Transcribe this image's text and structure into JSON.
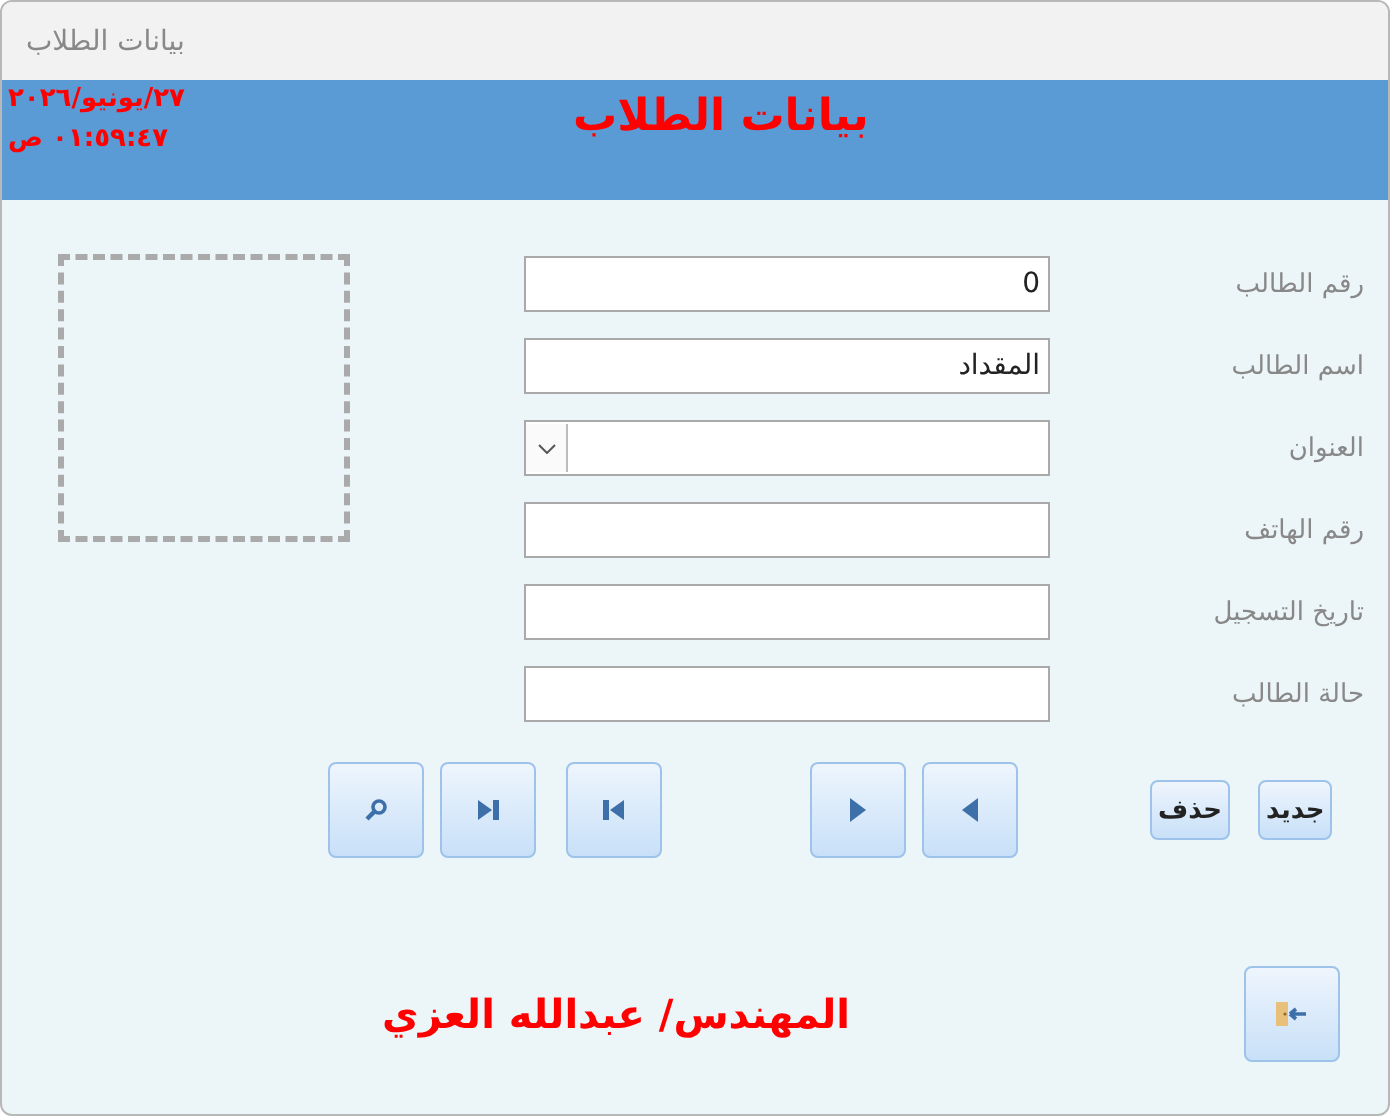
{
  "window": {
    "title": "بيانات الطلاب"
  },
  "header": {
    "title": "بيانات الطلاب",
    "date": "٢٧/يونيو/٢٠٢٦",
    "time": "٠١:٥٩:٤٧ ص"
  },
  "fields": [
    {
      "label": "رقم الطالب",
      "kind": "text",
      "value": "0"
    },
    {
      "label": "اسم الطالب",
      "kind": "text",
      "value": "المقداد"
    },
    {
      "label": "العنوان",
      "kind": "combo"
    },
    {
      "label": "رقم الهاتف",
      "kind": "text"
    },
    {
      "label": "تاريخ التسجيل",
      "kind": "text"
    },
    {
      "label": "حالة الطالب",
      "kind": "text"
    }
  ],
  "nav_buttons": [
    {
      "kind": "search"
    },
    {
      "kind": "last"
    },
    {
      "kind": "first"
    },
    {
      "kind": "next"
    },
    {
      "kind": "previous"
    }
  ],
  "action_buttons": [
    {
      "label": "جديد"
    },
    {
      "label": "حذف"
    }
  ],
  "footer": {
    "credit": "المهندس/ عبدالله العزي"
  }
}
